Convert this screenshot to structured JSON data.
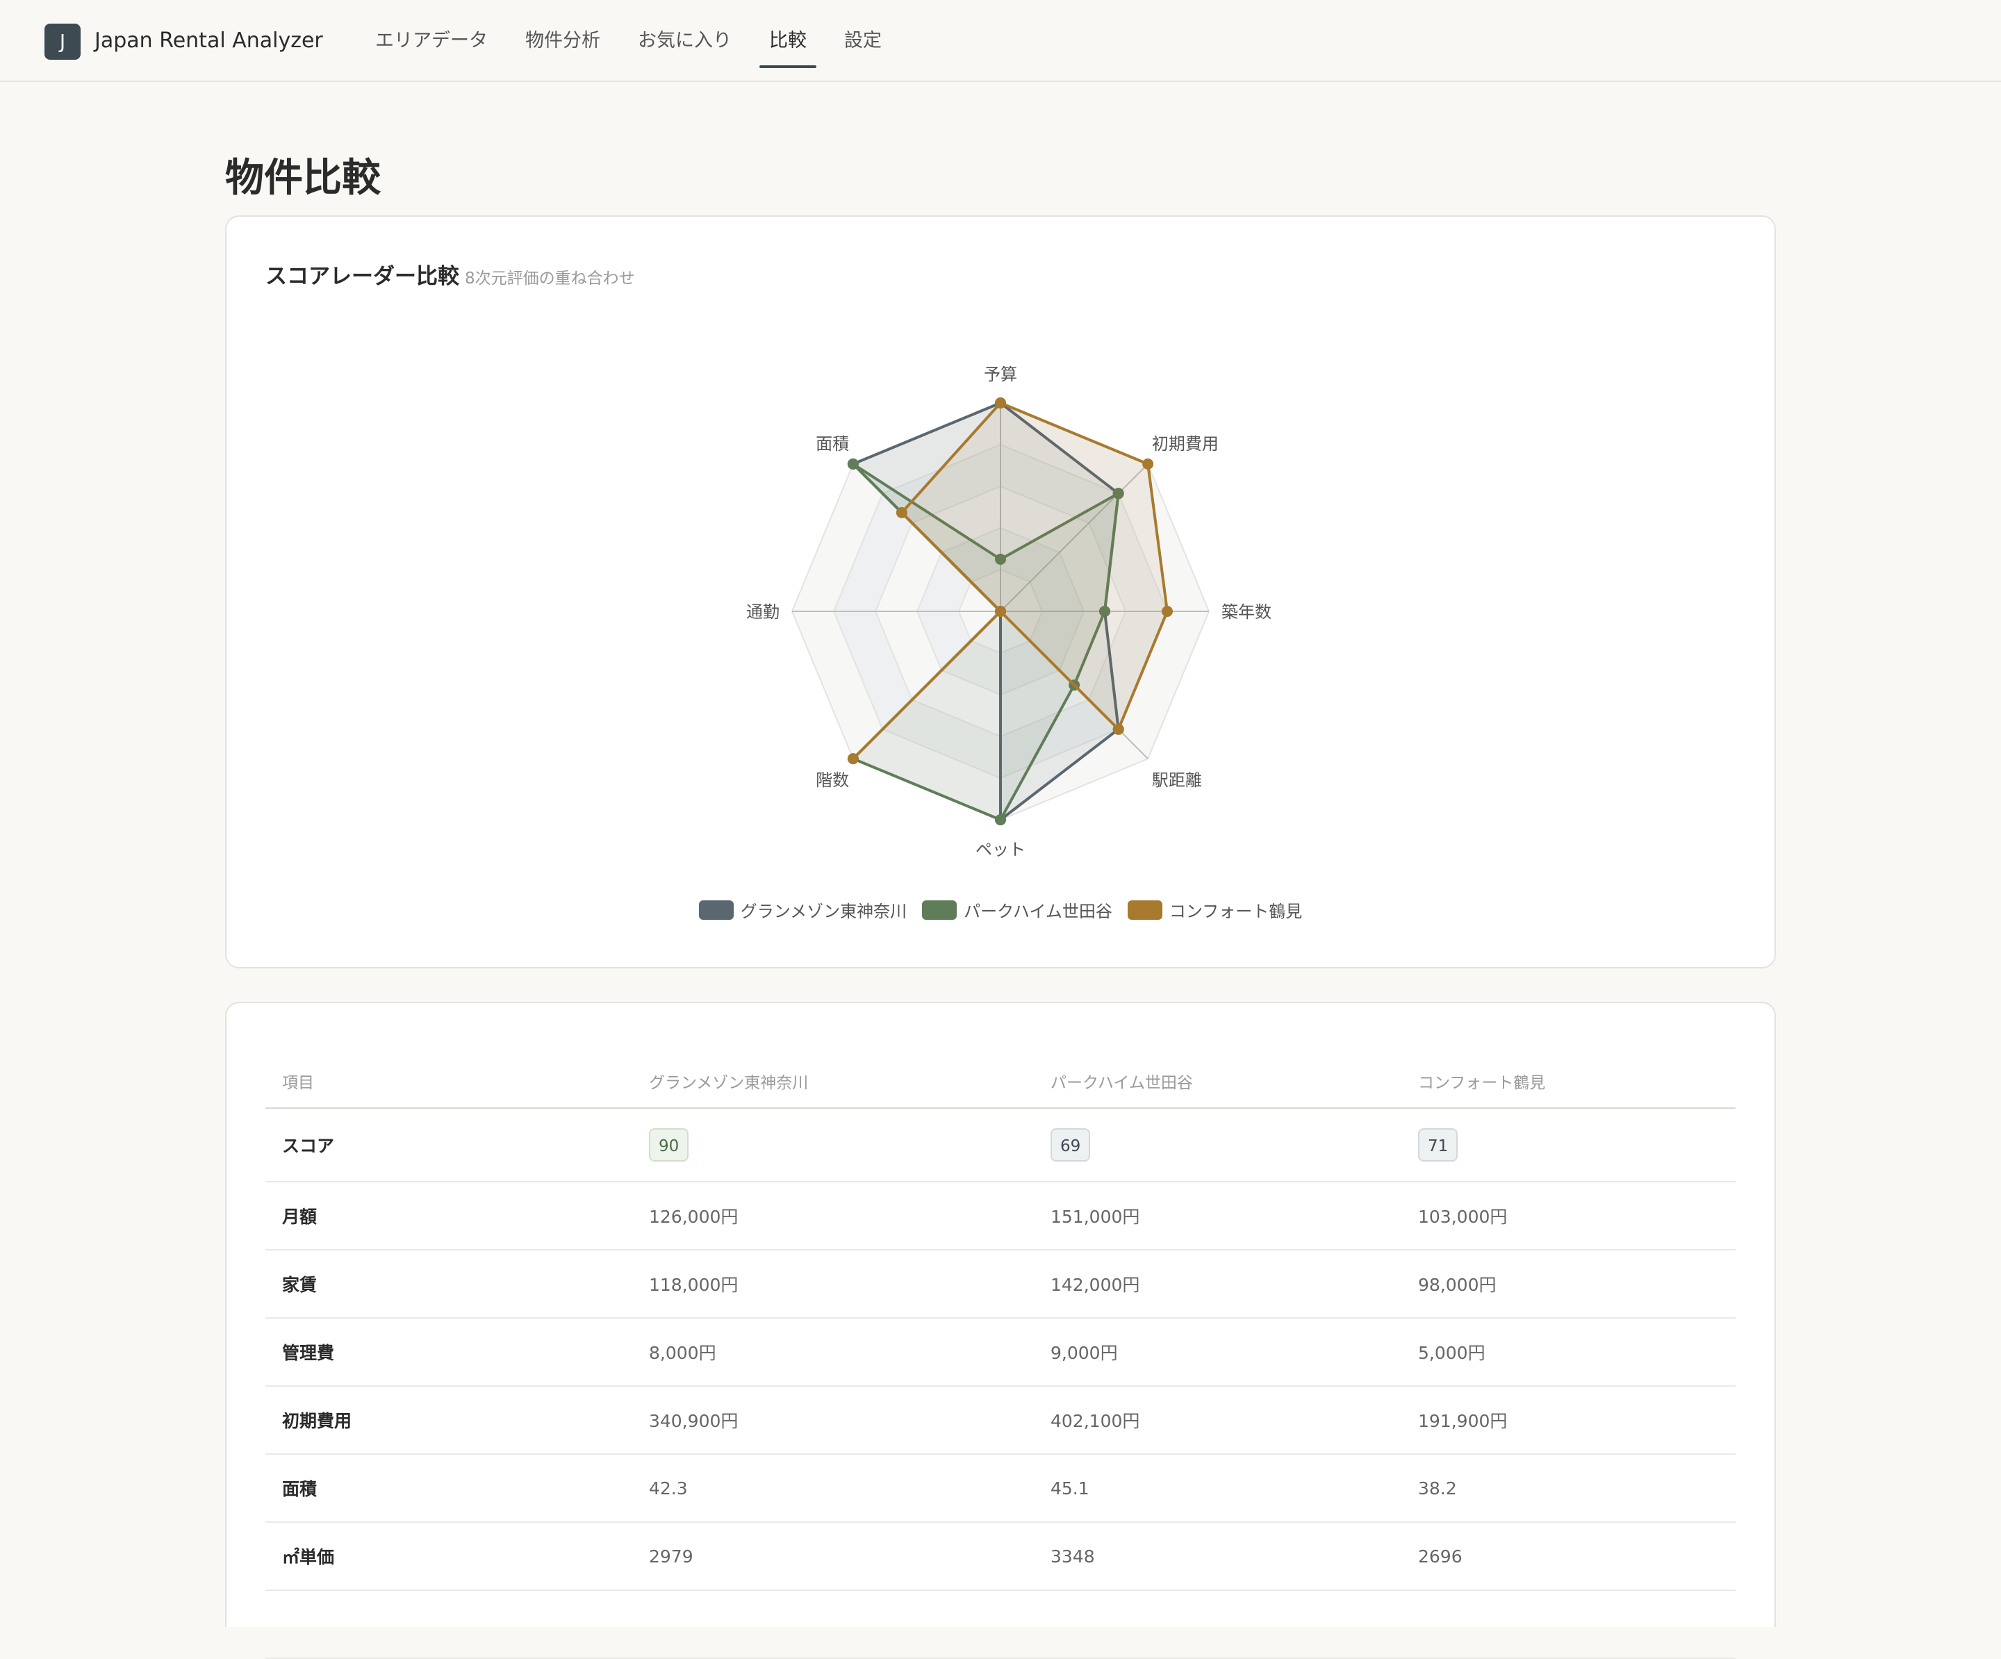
{
  "header": {
    "logo_letter": "J",
    "app_title": "Japan Rental Analyzer",
    "nav": [
      {
        "label": "エリアデータ",
        "active": false
      },
      {
        "label": "物件分析",
        "active": false
      },
      {
        "label": "お気に入り",
        "active": false
      },
      {
        "label": "比較",
        "active": true
      },
      {
        "label": "設定",
        "active": false
      }
    ]
  },
  "page": {
    "title": "物件比較"
  },
  "radar_card": {
    "title": "スコアレーダー比較",
    "subtitle": "8次元評価の重ね合わせ"
  },
  "chart_data": {
    "type": "radar",
    "axes": [
      "予算",
      "初期費用",
      "築年数",
      "駅距離",
      "ペット",
      "階数",
      "通勤",
      "面積"
    ],
    "range": [
      0,
      100
    ],
    "grid_levels": 5,
    "legend_position": "bottom-center",
    "series": [
      {
        "name": "グランメゾン東神奈川",
        "color": "#5a6770",
        "values": [
          100,
          80,
          50,
          80,
          100,
          0,
          0,
          100
        ]
      },
      {
        "name": "パークハイム世田谷",
        "color": "#5f7d58",
        "values": [
          25,
          80,
          50,
          50,
          100,
          100,
          0,
          100
        ]
      },
      {
        "name": "コンフォート鶴見",
        "color": "#a87a2e",
        "values": [
          100,
          100,
          80,
          80,
          0,
          100,
          0,
          67
        ]
      }
    ]
  },
  "table": {
    "headers": [
      "項目",
      "グランメゾン東神奈川",
      "パークハイム世田谷",
      "コンフォート鶴見"
    ],
    "score_row": {
      "label": "スコア",
      "values": [
        "90",
        "69",
        "71"
      ],
      "levels": [
        "high",
        "mid",
        "mid"
      ]
    },
    "rows": [
      {
        "label": "月額",
        "values": [
          "126,000円",
          "151,000円",
          "103,000円"
        ]
      },
      {
        "label": "家賃",
        "values": [
          "118,000円",
          "142,000円",
          "98,000円"
        ]
      },
      {
        "label": "管理費",
        "values": [
          "8,000円",
          "9,000円",
          "5,000円"
        ]
      },
      {
        "label": "初期費用",
        "values": [
          "340,900円",
          "402,100円",
          "191,900円"
        ]
      },
      {
        "label": "面積",
        "values": [
          "42.3",
          "45.1",
          "38.2"
        ]
      },
      {
        "label": "㎡単価",
        "values": [
          "2979",
          "3348",
          "2696"
        ]
      },
      {
        "label": "",
        "values": [
          "",
          "",
          ""
        ]
      }
    ]
  }
}
